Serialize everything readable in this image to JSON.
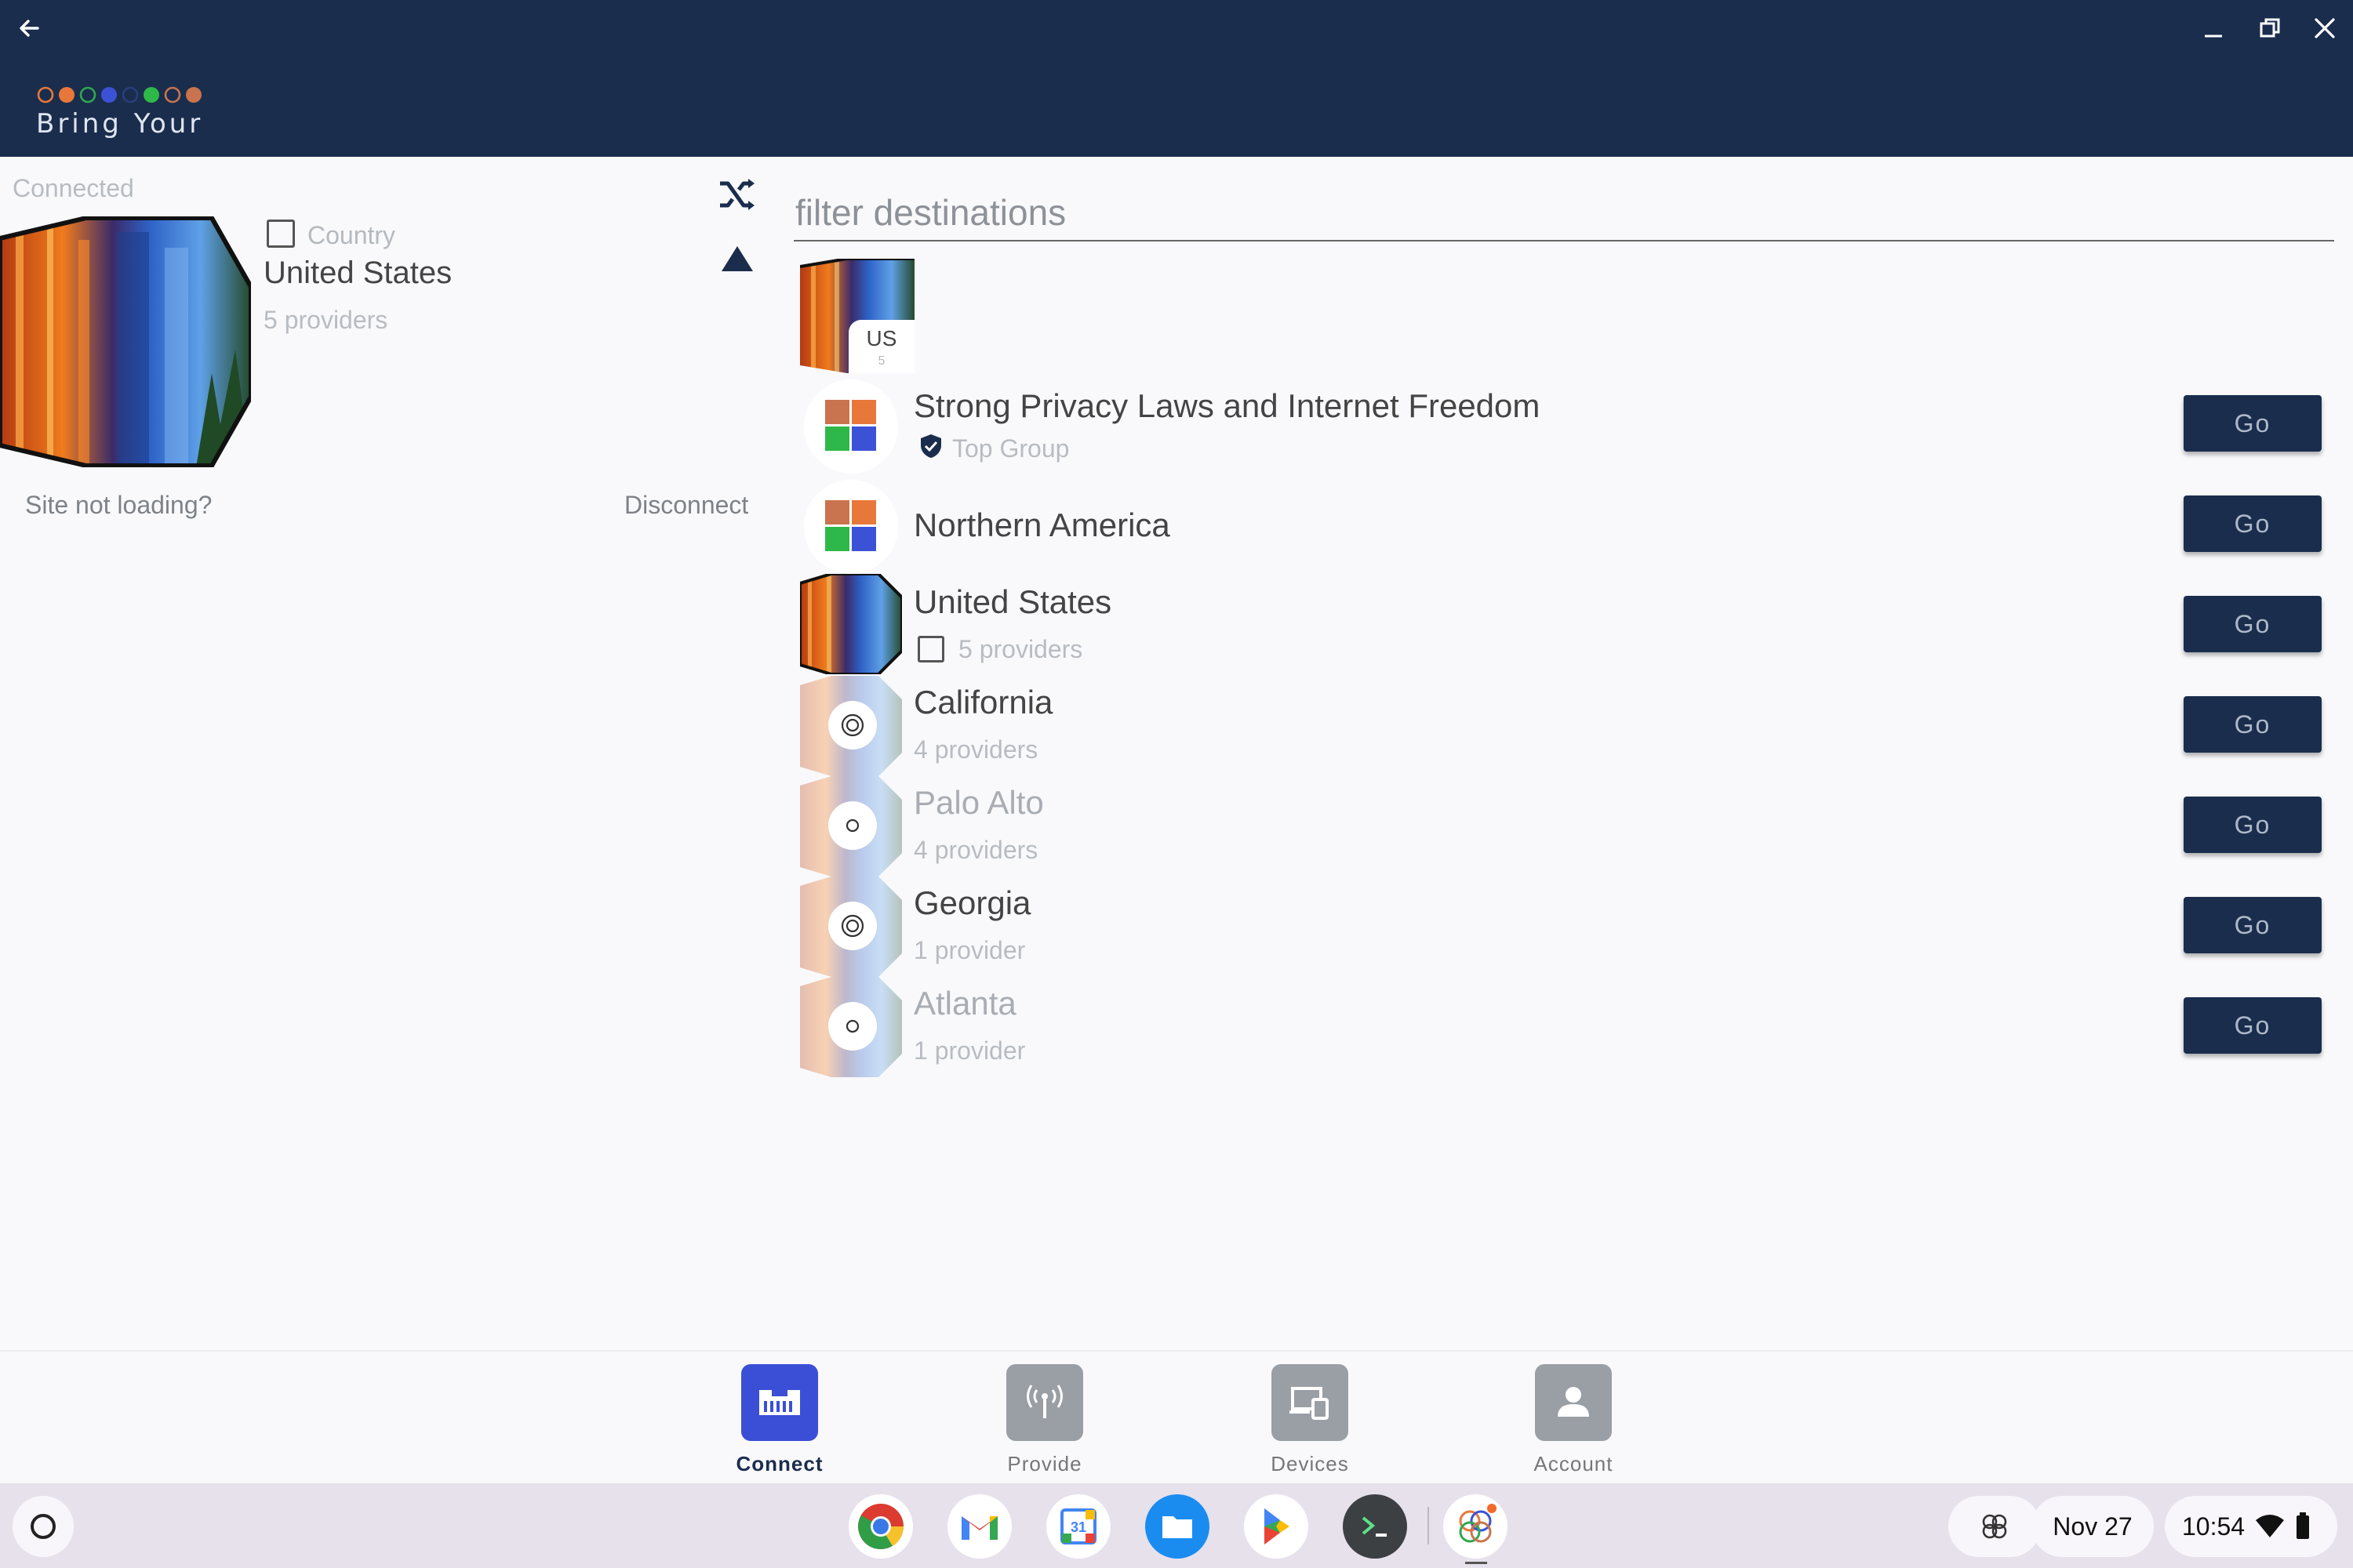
{
  "logo": {
    "text": "Bring Your",
    "dot_colors": [
      "#e8783a",
      "#e8783a",
      "#2fa84f",
      "#3c52d6",
      "#26407a",
      "#2fb84a",
      "#c9744f",
      "#e8783a"
    ]
  },
  "connected": {
    "status": "Connected",
    "country_label": "Country",
    "location_name": "United States",
    "providers": "5 providers",
    "site_link": "Site not loading?",
    "disconnect_label": "Disconnect"
  },
  "filter": {
    "placeholder": "filter destinations",
    "value": ""
  },
  "us_tile": {
    "code": "US",
    "sub": "5"
  },
  "destinations": [
    {
      "title": "Strong Privacy Laws and Internet Freedom",
      "sub": "Top Group",
      "go": "Go",
      "thumb": "group"
    },
    {
      "title": "Northern America",
      "sub": "",
      "go": "Go",
      "thumb": "group"
    },
    {
      "title": "United States",
      "sub": "5 providers",
      "go": "Go",
      "thumb": "country"
    },
    {
      "title": "California",
      "sub": "4 providers",
      "go": "Go",
      "thumb": "region"
    },
    {
      "title": "Palo Alto",
      "sub": "4 providers",
      "go": "Go",
      "thumb": "city"
    },
    {
      "title": "Georgia",
      "sub": "1 provider",
      "go": "Go",
      "thumb": "region"
    },
    {
      "title": "Atlanta",
      "sub": "1 provider",
      "go": "Go",
      "thumb": "city"
    }
  ],
  "nav": [
    {
      "label": "Connect",
      "icon": "network-icon",
      "active": true
    },
    {
      "label": "Provide",
      "icon": "antenna-icon",
      "active": false
    },
    {
      "label": "Devices",
      "icon": "devices-icon",
      "active": false
    },
    {
      "label": "Account",
      "icon": "person-icon",
      "active": false
    }
  ],
  "shelf": {
    "apps": [
      "chrome-icon",
      "gmail-icon",
      "calendar-icon",
      "files-icon",
      "play-store-icon",
      "terminal-icon",
      "urnetwork-icon"
    ],
    "calendar_day": "31",
    "date": "Nov 27",
    "time": "10:54"
  },
  "colors": {
    "appbar": "#1a2d4d",
    "accent": "#3b4fd6",
    "button": "#1a2d4d"
  }
}
